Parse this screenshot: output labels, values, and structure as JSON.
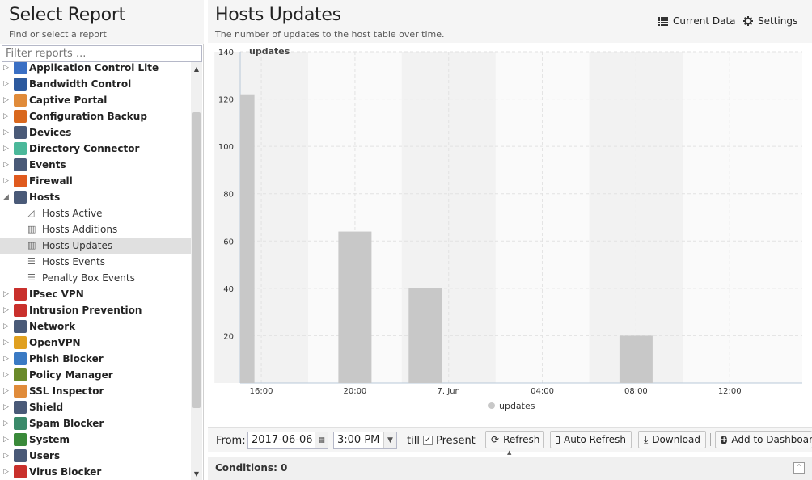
{
  "sidebar": {
    "title": "Select Report",
    "subtitle": "Find or select a report",
    "filter_placeholder": "Filter reports ...",
    "items": [
      {
        "label": "Application Control Lite",
        "icon": "app-control-lite-icon",
        "color": "#3a6fc4"
      },
      {
        "label": "Bandwidth Control",
        "icon": "bandwidth-icon",
        "color": "#2d5a9e"
      },
      {
        "label": "Captive Portal",
        "icon": "captive-portal-icon",
        "color": "#e08b3a"
      },
      {
        "label": "Configuration Backup",
        "icon": "config-backup-icon",
        "color": "#d9681e"
      },
      {
        "label": "Devices",
        "icon": "devices-icon",
        "color": "#4a5a78"
      },
      {
        "label": "Directory Connector",
        "icon": "directory-icon",
        "color": "#4bb89a"
      },
      {
        "label": "Events",
        "icon": "events-icon",
        "color": "#4a5a78"
      },
      {
        "label": "Firewall",
        "icon": "firewall-icon",
        "color": "#e05a1e"
      },
      {
        "label": "Hosts",
        "icon": "hosts-icon",
        "color": "#4a5a78",
        "expanded": true,
        "children": [
          {
            "label": "Hosts Active",
            "icon": "area-chart-icon"
          },
          {
            "label": "Hosts Additions",
            "icon": "bar-chart-icon"
          },
          {
            "label": "Hosts Updates",
            "icon": "bar-chart-icon",
            "selected": true
          },
          {
            "label": "Hosts Events",
            "icon": "list-icon"
          },
          {
            "label": "Penalty Box Events",
            "icon": "list-icon"
          }
        ]
      },
      {
        "label": "IPsec VPN",
        "icon": "ipsec-icon",
        "color": "#c9302c"
      },
      {
        "label": "Intrusion Prevention",
        "icon": "intrusion-icon",
        "color": "#c9302c"
      },
      {
        "label": "Network",
        "icon": "network-icon",
        "color": "#4a5a78"
      },
      {
        "label": "OpenVPN",
        "icon": "openvpn-icon",
        "color": "#e0a020"
      },
      {
        "label": "Phish Blocker",
        "icon": "phish-icon",
        "color": "#3a7ac4"
      },
      {
        "label": "Policy Manager",
        "icon": "policy-icon",
        "color": "#6a8a2a"
      },
      {
        "label": "SSL Inspector",
        "icon": "ssl-icon",
        "color": "#e08b3a"
      },
      {
        "label": "Shield",
        "icon": "shield-icon",
        "color": "#4a5a78"
      },
      {
        "label": "Spam Blocker",
        "icon": "spam-icon",
        "color": "#3a8a6a"
      },
      {
        "label": "System",
        "icon": "system-icon",
        "color": "#3a8a3a"
      },
      {
        "label": "Users",
        "icon": "users-icon",
        "color": "#4a5a78"
      },
      {
        "label": "Virus Blocker",
        "icon": "virus-icon",
        "color": "#c9302c"
      }
    ]
  },
  "main": {
    "title": "Hosts Updates",
    "subtitle": "The number of updates to the host table over time.",
    "current_data_label": "Current Data",
    "settings_label": "Settings"
  },
  "chart_data": {
    "type": "bar",
    "title": "",
    "xlabel": "",
    "ylabel": "updates",
    "ylim": [
      0,
      140
    ],
    "yticks": [
      20,
      40,
      60,
      80,
      100,
      120,
      140
    ],
    "x_tick_labels": [
      "16:00",
      "20:00",
      "7. Jun",
      "04:00",
      "08:00",
      "12:00"
    ],
    "x_tick_hours": [
      16,
      20,
      24,
      28,
      32,
      36
    ],
    "xrange_hours": [
      15.1,
      39.1
    ],
    "grid": true,
    "legend": "bottom-center",
    "series": [
      {
        "name": "updates",
        "color": "#c8c8c8",
        "bars": [
          {
            "time": "2017-06-06 15:00",
            "hour": 15.0,
            "value": 122
          },
          {
            "time": "2017-06-06 20:00",
            "hour": 20.0,
            "value": 64
          },
          {
            "time": "2017-06-06 23:00",
            "hour": 23.0,
            "value": 40
          },
          {
            "time": "2017-06-07 08:00",
            "hour": 32.0,
            "value": 20
          }
        ]
      }
    ]
  },
  "toolbar": {
    "from_label": "From:",
    "from_date": "2017-06-06",
    "from_time": "3:00 PM",
    "till_label": "till",
    "present_label": "Present",
    "present_checked": true,
    "refresh_label": "Refresh",
    "auto_refresh_label": "Auto Refresh",
    "download_label": "Download",
    "add_dashboard_label": "Add to Dashboard"
  },
  "conditions": {
    "label": "Conditions: 0"
  }
}
